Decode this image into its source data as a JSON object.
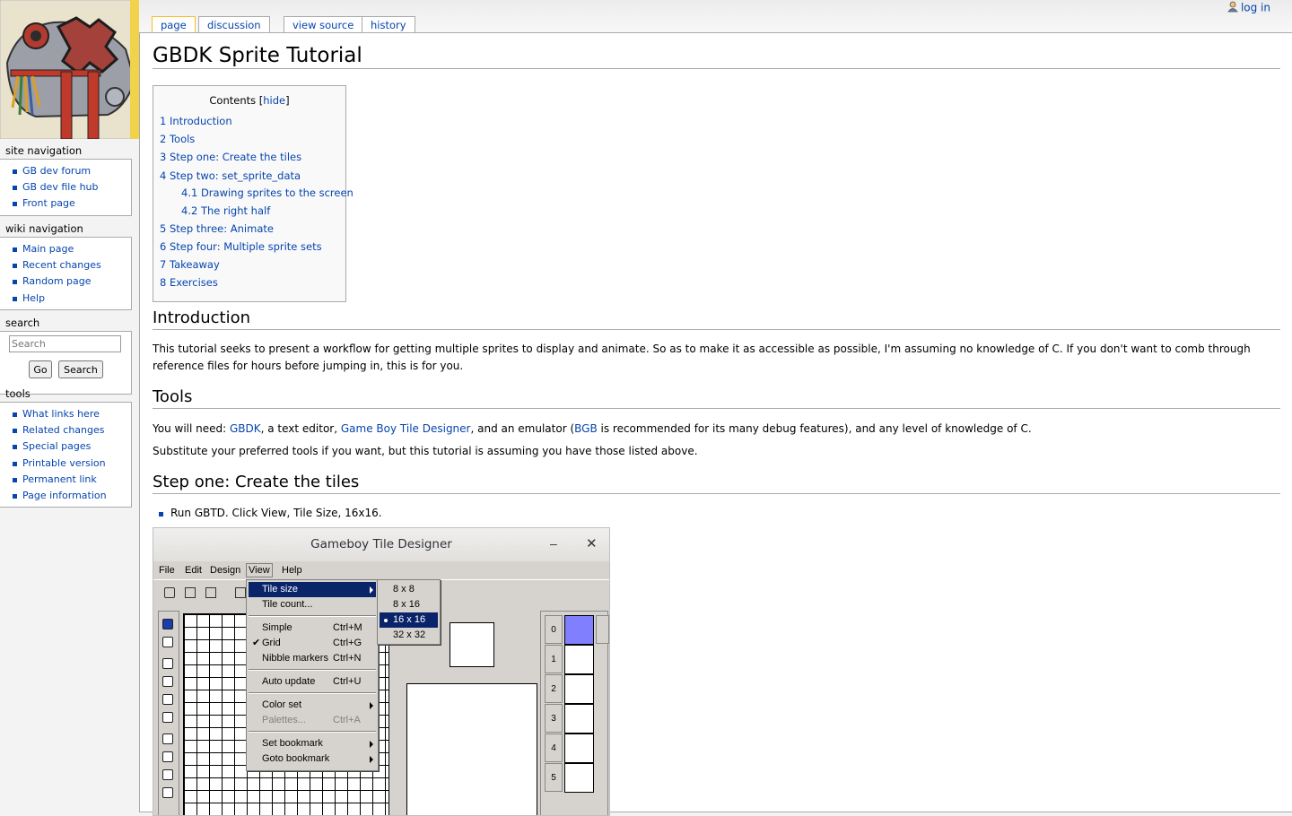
{
  "personal": {
    "login": "log in"
  },
  "tabs": [
    {
      "label": "page"
    },
    {
      "label": "discussion"
    },
    {
      "label": "view source"
    },
    {
      "label": "history"
    }
  ],
  "sidebar": {
    "site_nav": {
      "title": "site navigation",
      "items": [
        "GB dev forum",
        "GB dev file hub",
        "Front page"
      ]
    },
    "wiki_nav": {
      "title": "wiki navigation",
      "items": [
        "Main page",
        "Recent changes",
        "Random page",
        "Help"
      ]
    },
    "search": {
      "title": "search",
      "placeholder": "Search",
      "go": "Go",
      "search": "Search"
    },
    "tools": {
      "title": "tools",
      "items": [
        "What links here",
        "Related changes",
        "Special pages",
        "Printable version",
        "Permanent link",
        "Page information"
      ]
    }
  },
  "page": {
    "title": "GBDK Sprite Tutorial",
    "toc": {
      "title": "Contents",
      "hide": "hide",
      "items": [
        "1 Introduction",
        "2 Tools",
        "3 Step one: Create the tiles",
        "4 Step two: set_sprite_data",
        "4.1 Drawing sprites to the screen",
        "4.2 The right half",
        "5 Step three: Animate",
        "6 Step four: Multiple sprite sets",
        "7 Takeaway",
        "8 Exercises"
      ]
    },
    "intro": {
      "heading": "Introduction",
      "text": "This tutorial seeks to present a workflow for getting multiple sprites to display and animate. So as to make it as accessible as possible, I'm assuming no knowledge of C. If you don't want to comb through reference files for hours before jumping in, this is for you."
    },
    "tools": {
      "heading": "Tools",
      "p1_a": "You will need: ",
      "link_gbdk": "GBDK",
      "p1_b": ", a text editor, ",
      "link_gbtd": "Game Boy Tile Designer",
      "p1_c": ", and an emulator (",
      "link_bgb": "BGB",
      "p1_d": " is recommended for its many debug features), and any level of knowledge of C.",
      "p2": "Substitute your preferred tools if you want, but this tutorial is assuming you have those listed above."
    },
    "step1": {
      "heading": "Step one: Create the tiles",
      "bullet": "Run GBTD. Click View, Tile Size, 16x16."
    }
  },
  "gbtd": {
    "window_title": "Gameboy Tile Designer",
    "menus": [
      "File",
      "Edit",
      "Design",
      "View",
      "Help"
    ],
    "view_menu": [
      {
        "label": "Tile size",
        "shortcut": "",
        "submenu": true
      },
      {
        "label": "Tile count...",
        "shortcut": ""
      },
      {
        "label": "Simple",
        "shortcut": "Ctrl+M"
      },
      {
        "label": "Grid",
        "shortcut": "Ctrl+G"
      },
      {
        "label": "Nibble markers",
        "shortcut": "Ctrl+N"
      },
      {
        "label": "Auto update",
        "shortcut": "Ctrl+U"
      },
      {
        "label": "Color set",
        "shortcut": ""
      },
      {
        "label": "Palettes...",
        "shortcut": "Ctrl+A"
      },
      {
        "label": "Set bookmark",
        "shortcut": ""
      },
      {
        "label": "Goto bookmark",
        "shortcut": ""
      }
    ],
    "size_menu": [
      "8 x 8",
      "8 x 16",
      "16 x 16",
      "32 x 32"
    ],
    "tile_numbers": [
      "0",
      "1",
      "2",
      "3",
      "4",
      "5"
    ]
  }
}
